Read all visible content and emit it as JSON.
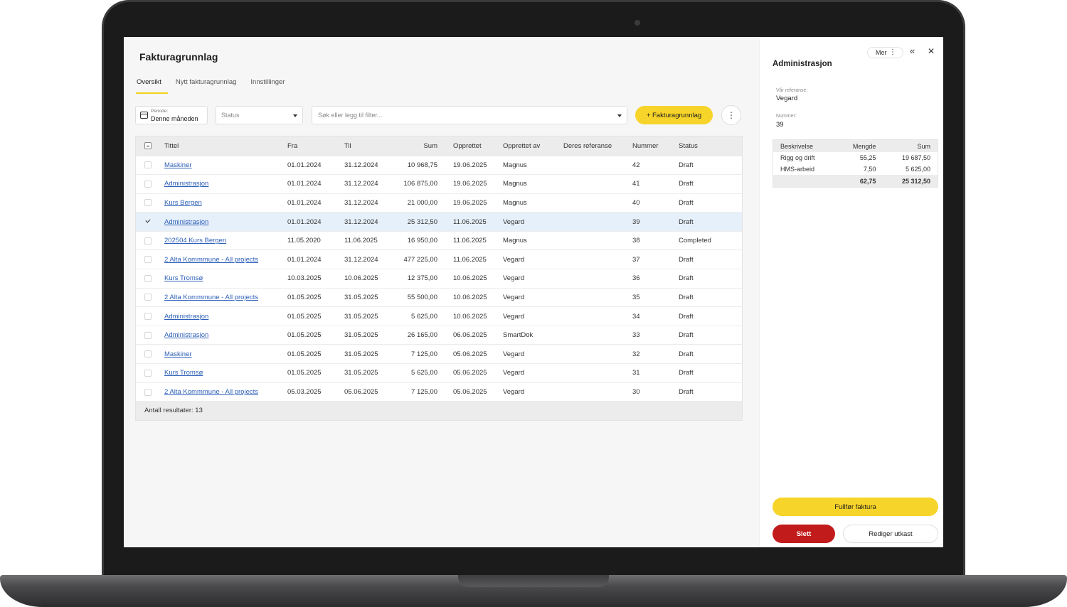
{
  "page": {
    "title": "Fakturagrunnlag",
    "tabs": [
      {
        "label": "Oversikt",
        "active": true
      },
      {
        "label": "Nytt fakturagrunnlag",
        "active": false
      },
      {
        "label": "Innstillinger",
        "active": false
      }
    ]
  },
  "filters": {
    "period_label": "Periode:",
    "period_value": "Denne måneden",
    "status_placeholder": "Status",
    "search_placeholder": "Søk eller legg til filter...",
    "add_button": "+ Fakturagrunnlag",
    "more_icon": "⋮"
  },
  "table": {
    "columns": [
      "Tittel",
      "Fra",
      "Til",
      "Sum",
      "Opprettet",
      "Opprettet av",
      "Deres referanse",
      "Nummer",
      "Status"
    ],
    "rows": [
      {
        "title": "Maskiner",
        "from": "01.01.2024",
        "to": "31.12.2024",
        "sum": "10 968,75",
        "created": "19.06.2025",
        "created_by": "Magnus",
        "ref": "",
        "number": "42",
        "status": "Draft"
      },
      {
        "title": "Administrasjon",
        "from": "01.01.2024",
        "to": "31.12.2024",
        "sum": "106 875,00",
        "created": "19.06.2025",
        "created_by": "Magnus",
        "ref": "",
        "number": "41",
        "status": "Draft"
      },
      {
        "title": "Kurs Bergen",
        "from": "01.01.2024",
        "to": "31.12.2024",
        "sum": "21 000,00",
        "created": "19.06.2025",
        "created_by": "Magnus",
        "ref": "",
        "number": "40",
        "status": "Draft"
      },
      {
        "title": "Administrasjon",
        "from": "01.01.2024",
        "to": "31.12.2024",
        "sum": "25 312,50",
        "created": "11.06.2025",
        "created_by": "Vegard",
        "ref": "",
        "number": "39",
        "status": "Draft"
      },
      {
        "title": "202504 Kurs Bergen",
        "from": "11.05.2020",
        "to": "11.06.2025",
        "sum": "16 950,00",
        "created": "11.06.2025",
        "created_by": "Magnus",
        "ref": "",
        "number": "38",
        "status": "Completed"
      },
      {
        "title": "2 Alta Kommmune - All projects",
        "from": "01.01.2024",
        "to": "31.12.2024",
        "sum": "477 225,00",
        "created": "11.06.2025",
        "created_by": "Vegard",
        "ref": "",
        "number": "37",
        "status": "Draft"
      },
      {
        "title": "Kurs Tromsø",
        "from": "10.03.2025",
        "to": "10.06.2025",
        "sum": "12 375,00",
        "created": "10.06.2025",
        "created_by": "Vegard",
        "ref": "",
        "number": "36",
        "status": "Draft"
      },
      {
        "title": "2 Alta Kommmune - All projects",
        "from": "01.05.2025",
        "to": "31.05.2025",
        "sum": "55 500,00",
        "created": "10.06.2025",
        "created_by": "Vegard",
        "ref": "",
        "number": "35",
        "status": "Draft"
      },
      {
        "title": "Administrasjon",
        "from": "01.05.2025",
        "to": "31.05.2025",
        "sum": "5 625,00",
        "created": "10.06.2025",
        "created_by": "Vegard",
        "ref": "",
        "number": "34",
        "status": "Draft"
      },
      {
        "title": "Administrasjon",
        "from": "01.05.2025",
        "to": "31.05.2025",
        "sum": "26 165,00",
        "created": "06.06.2025",
        "created_by": "SmartDok",
        "ref": "",
        "number": "33",
        "status": "Draft"
      },
      {
        "title": "Maskiner",
        "from": "01.05.2025",
        "to": "31.05.2025",
        "sum": "7 125,00",
        "created": "05.06.2025",
        "created_by": "Vegard",
        "ref": "",
        "number": "32",
        "status": "Draft"
      },
      {
        "title": "Kurs Tromsø",
        "from": "01.05.2025",
        "to": "31.05.2025",
        "sum": "5 625,00",
        "created": "05.06.2025",
        "created_by": "Vegard",
        "ref": "",
        "number": "31",
        "status": "Draft"
      },
      {
        "title": "2 Alta Kommmune - All projects",
        "from": "05.03.2025",
        "to": "05.06.2025",
        "sum": "7 125,00",
        "created": "05.06.2025",
        "created_by": "Vegard",
        "ref": "",
        "number": "30",
        "status": "Draft"
      }
    ],
    "selected_index": 3,
    "footer": "Antall resultater: 13"
  },
  "panel": {
    "more_label": "Mer",
    "title": "Administrasjon",
    "our_ref_label": "Vår referanse:",
    "our_ref_value": "Vegard",
    "number_label": "Nummer:",
    "number_value": "39",
    "lines": {
      "columns": [
        "Beskrivelse",
        "Mengde",
        "Sum"
      ],
      "rows": [
        {
          "desc": "Rigg og drift",
          "qty": "55,25",
          "sum": "19 687,50"
        },
        {
          "desc": "HMS-arbeid",
          "qty": "7,50",
          "sum": "5 625,00"
        }
      ],
      "total_qty": "62,75",
      "total_sum": "25 312,50"
    },
    "finish_button": "Fullfør faktura",
    "delete_button": "Slett",
    "edit_button": "Rediger utkast"
  },
  "colors": {
    "accent": "#f7d42a",
    "danger": "#c11b1b",
    "link": "#2d5fb8",
    "selected_row": "#e6f0fa"
  }
}
